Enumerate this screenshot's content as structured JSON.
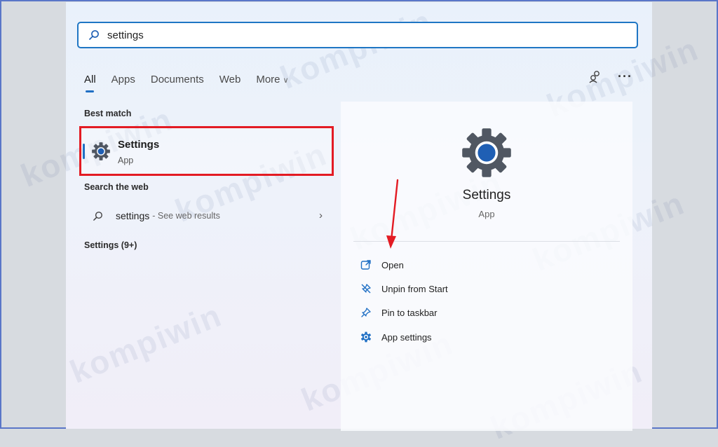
{
  "search": {
    "query": "settings"
  },
  "filters": {
    "all": "All",
    "apps": "Apps",
    "documents": "Documents",
    "web": "Web",
    "more": "More",
    "more_chevron": "∨",
    "overflow": "···"
  },
  "best_match": {
    "heading": "Best match",
    "name": "Settings",
    "type": "App"
  },
  "search_web": {
    "heading": "Search the web",
    "query": "settings",
    "hint": "- See web results",
    "arrow": "›"
  },
  "settings_group": {
    "heading": "Settings (9+)"
  },
  "preview": {
    "title": "Settings",
    "subtitle": "App",
    "actions": [
      {
        "label": "Open",
        "icon": "open-external-icon"
      },
      {
        "label": "Unpin from Start",
        "icon": "unpin-icon"
      },
      {
        "label": "Pin to taskbar",
        "icon": "pin-icon"
      },
      {
        "label": "App settings",
        "icon": "gear-icon"
      }
    ]
  },
  "watermark": {
    "text": "kompiwin"
  },
  "colors": {
    "accent": "#1f6fc4",
    "highlight": "#e31b23",
    "gear_body": "#505762",
    "gear_center": "#1f5fb4"
  }
}
